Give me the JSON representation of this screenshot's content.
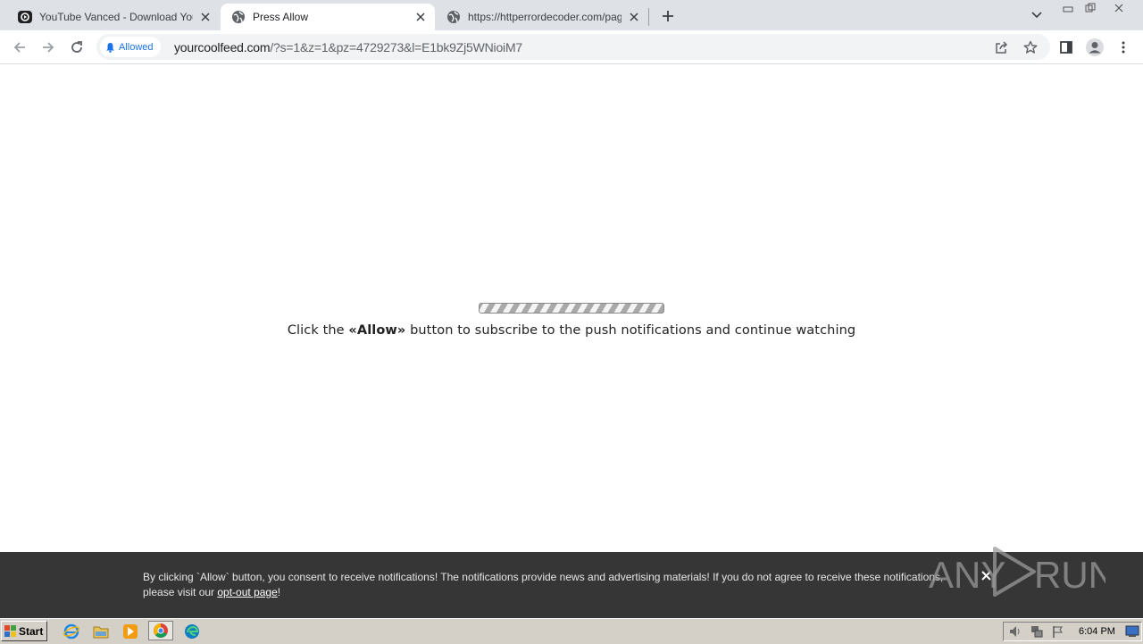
{
  "tabs": [
    {
      "title": "YouTube Vanced - Download YouTube",
      "favicon": "youtube-icon",
      "active": false
    },
    {
      "title": "Press Allow",
      "favicon": "globe-icon",
      "active": true
    },
    {
      "title": "https://httperrordecoder.com/page/",
      "favicon": "globe-icon",
      "active": false
    }
  ],
  "toolbar": {
    "permission_chip": "Allowed",
    "url_host": "yourcoolfeed.com",
    "url_path": "/?s=1&z=1&pz=4729273&l=E1bk9Zj5WNioiM7"
  },
  "content": {
    "message_prefix": "Click the ",
    "message_bold": "«Allow»",
    "message_suffix": " button to subscribe to the push notifications and continue watching"
  },
  "consent": {
    "text": "By clicking `Allow` button, you consent to receive notifications! The notifications provide news and advertising materials! If you do not agree to receive these notifications, please visit our ",
    "link": "opt-out page",
    "suffix": "!"
  },
  "watermark": {
    "left": "ANY",
    "right": "RUN"
  },
  "taskbar": {
    "start_label": "Start",
    "clock": "6:04 PM"
  },
  "colors": {
    "tabstrip": "#dee1e6",
    "accent": "#1a73e8",
    "consent_bg": "#363636",
    "taskbar": "#d4d0c8"
  }
}
